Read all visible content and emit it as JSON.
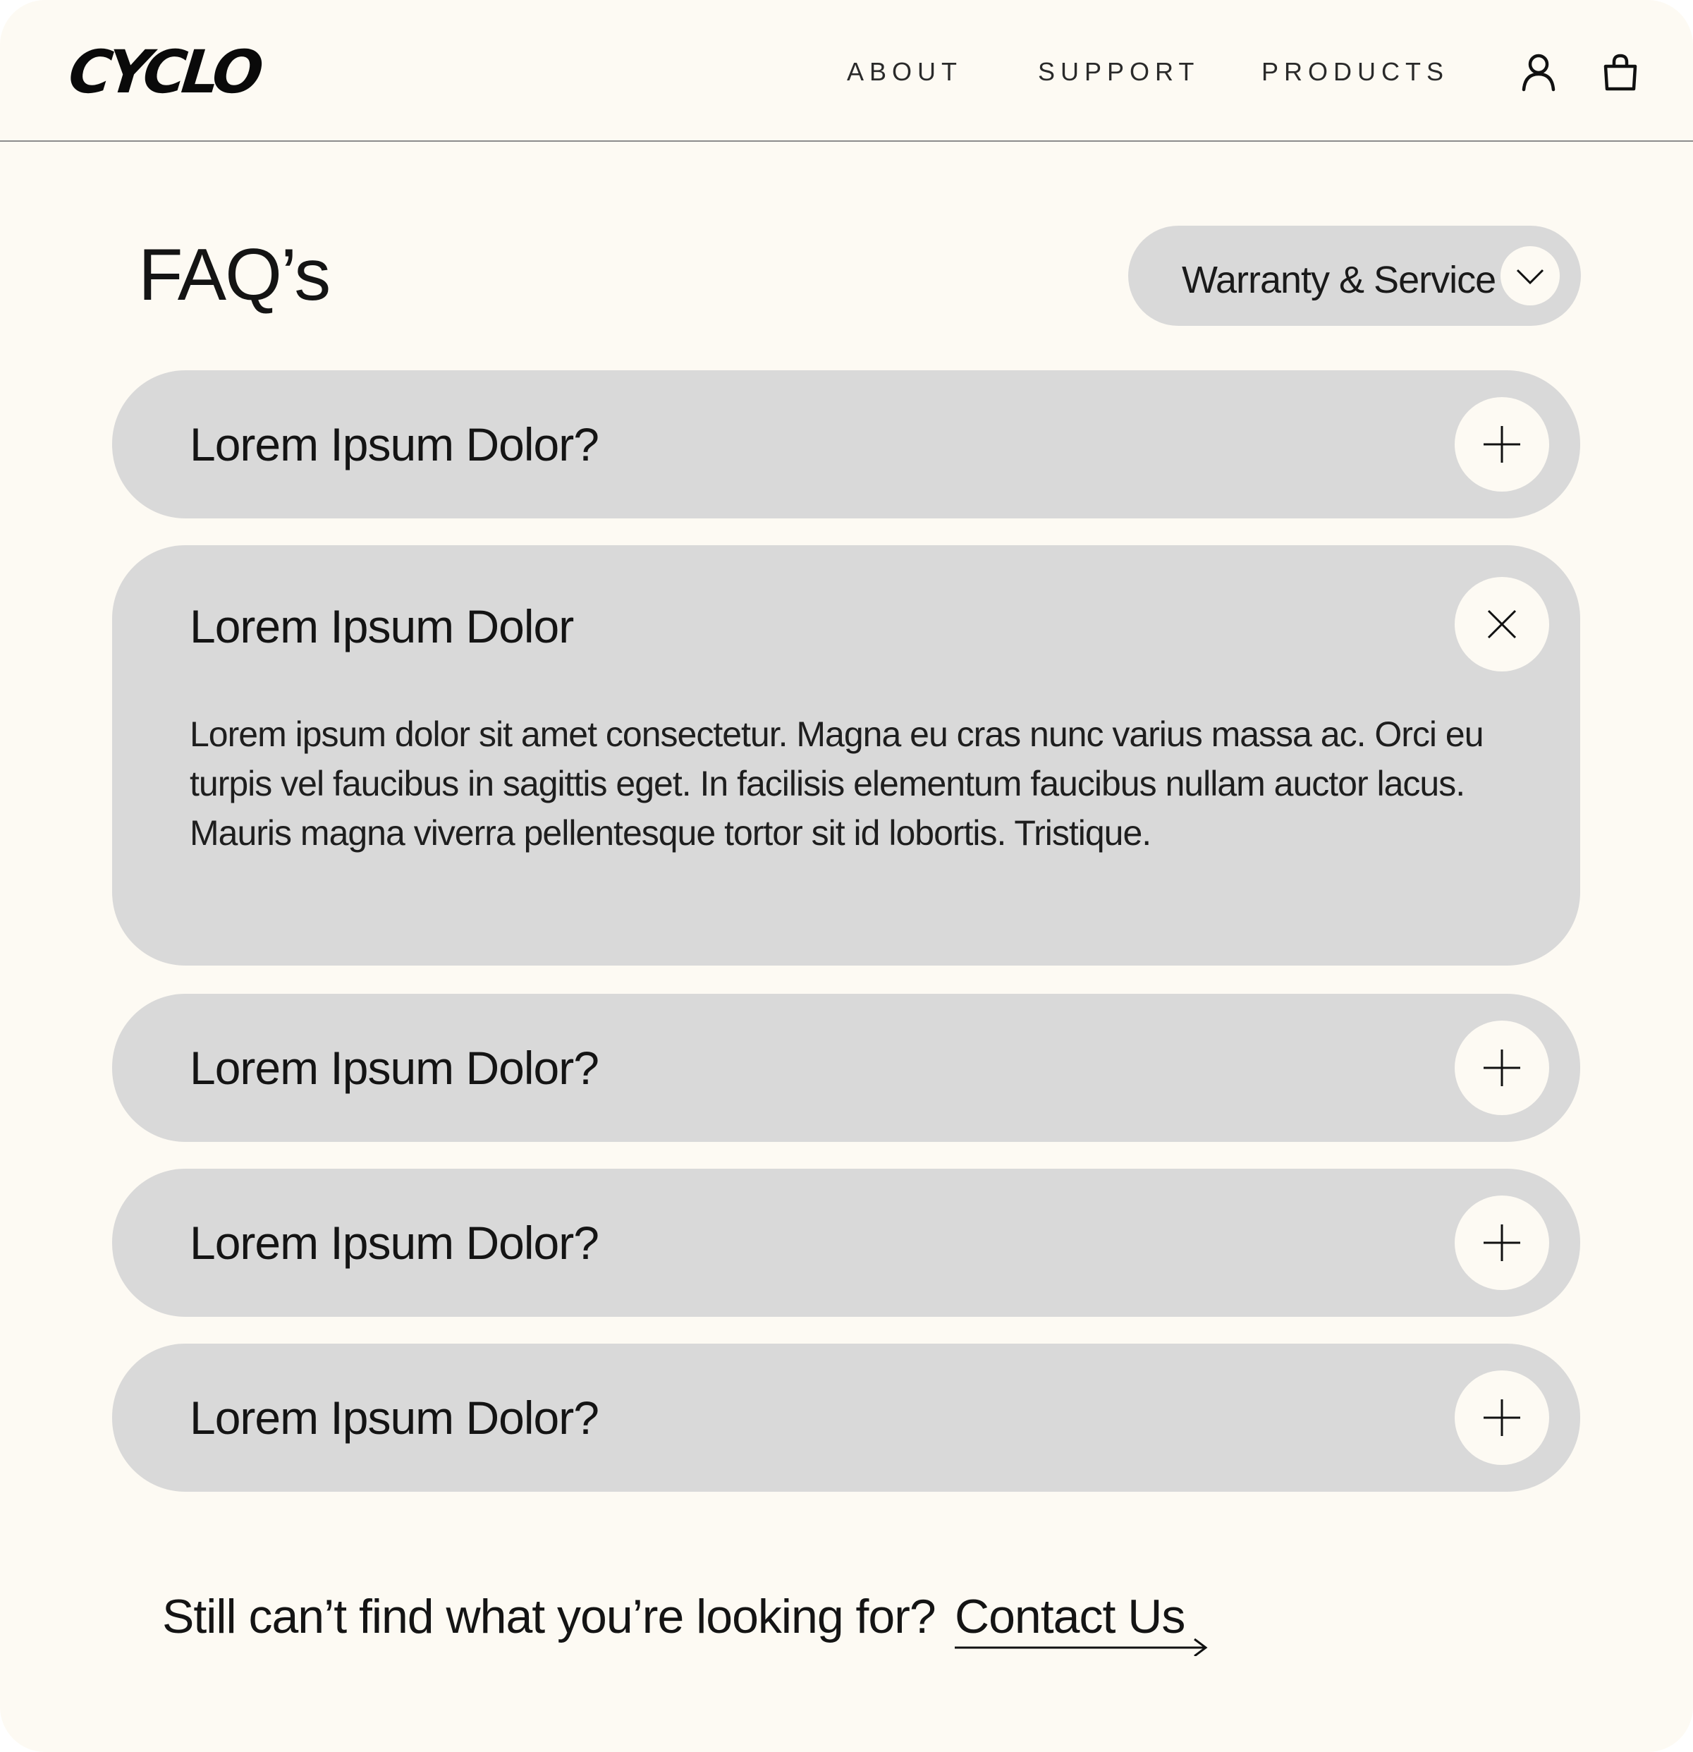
{
  "header": {
    "logo": "CYCLO",
    "nav": [
      {
        "label": "ABOUT"
      },
      {
        "label": "SUPPORT"
      },
      {
        "label": "PRODUCTS"
      }
    ],
    "icons": {
      "account": "user-icon",
      "cart": "shopping-bag-icon"
    }
  },
  "page": {
    "title": "FAQ’s",
    "filter": {
      "selected": "Warranty & Service",
      "icon": "chevron-down-icon"
    }
  },
  "faqs": [
    {
      "question": "Lorem Ipsum Dolor?",
      "expanded": false,
      "icon": "plus-icon"
    },
    {
      "question": "Lorem Ipsum Dolor",
      "expanded": true,
      "icon": "close-icon",
      "answer": "Lorem ipsum dolor sit amet consectetur. Magna eu cras nunc varius massa ac. Orci eu turpis vel faucibus in sagittis eget. In facilisis elementum faucibus nullam auctor lacus. Mauris magna viverra pellentesque tortor sit id lobortis. Tristique."
    },
    {
      "question": "Lorem Ipsum Dolor?",
      "expanded": false,
      "icon": "plus-icon"
    },
    {
      "question": "Lorem Ipsum Dolor?",
      "expanded": false,
      "icon": "plus-icon"
    },
    {
      "question": "Lorem Ipsum Dolor?",
      "expanded": false,
      "icon": "plus-icon"
    }
  ],
  "footer": {
    "prompt": "Still can’t find what you’re looking for?",
    "link": "Contact Us",
    "link_icon": "arrow-right-icon"
  },
  "colors": {
    "background": "#fdfaf3",
    "card": "#d9d9d9",
    "text": "#141414"
  }
}
